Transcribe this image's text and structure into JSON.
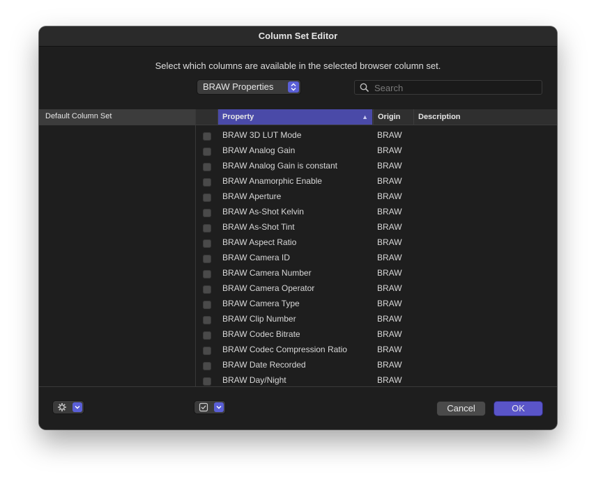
{
  "window": {
    "title": "Column Set Editor"
  },
  "header": {
    "instruction": "Select which columns are available in the selected browser column set."
  },
  "column_set_popup": {
    "value": "BRAW Properties"
  },
  "search": {
    "placeholder": "Search",
    "value": ""
  },
  "sidebar": {
    "items": [
      {
        "label": "Default Column Set",
        "selected": true
      }
    ]
  },
  "table": {
    "columns": [
      {
        "label": "Property",
        "sorted": "ascending"
      },
      {
        "label": "Origin"
      },
      {
        "label": "Description"
      }
    ],
    "rows": [
      {
        "checked": false,
        "property": "BRAW 3D LUT Mode",
        "origin": "BRAW",
        "description": ""
      },
      {
        "checked": false,
        "property": "BRAW Analog Gain",
        "origin": "BRAW",
        "description": ""
      },
      {
        "checked": false,
        "property": "BRAW Analog Gain is constant",
        "origin": "BRAW",
        "description": ""
      },
      {
        "checked": false,
        "property": "BRAW Anamorphic Enable",
        "origin": "BRAW",
        "description": ""
      },
      {
        "checked": false,
        "property": "BRAW Aperture",
        "origin": "BRAW",
        "description": ""
      },
      {
        "checked": false,
        "property": "BRAW As-Shot Kelvin",
        "origin": "BRAW",
        "description": ""
      },
      {
        "checked": false,
        "property": "BRAW As-Shot Tint",
        "origin": "BRAW",
        "description": ""
      },
      {
        "checked": false,
        "property": "BRAW Aspect Ratio",
        "origin": "BRAW",
        "description": ""
      },
      {
        "checked": false,
        "property": "BRAW Camera ID",
        "origin": "BRAW",
        "description": ""
      },
      {
        "checked": false,
        "property": "BRAW Camera Number",
        "origin": "BRAW",
        "description": ""
      },
      {
        "checked": false,
        "property": "BRAW Camera Operator",
        "origin": "BRAW",
        "description": ""
      },
      {
        "checked": false,
        "property": "BRAW Camera Type",
        "origin": "BRAW",
        "description": ""
      },
      {
        "checked": false,
        "property": "BRAW Clip Number",
        "origin": "BRAW",
        "description": ""
      },
      {
        "checked": false,
        "property": "BRAW Codec Bitrate",
        "origin": "BRAW",
        "description": ""
      },
      {
        "checked": false,
        "property": "BRAW Codec Compression Ratio",
        "origin": "BRAW",
        "description": ""
      },
      {
        "checked": false,
        "property": "BRAW Date Recorded",
        "origin": "BRAW",
        "description": ""
      },
      {
        "checked": false,
        "property": "BRAW Day/Night",
        "origin": "BRAW",
        "description": ""
      }
    ]
  },
  "footer": {
    "gear_menu_icon": "gear-icon",
    "check_menu_icon": "checkbox-icon",
    "cancel_label": "Cancel",
    "ok_label": "OK"
  },
  "colors": {
    "accent": "#5a55c9",
    "header_selected": "#4a4aa8",
    "background": "#1e1e1e"
  }
}
